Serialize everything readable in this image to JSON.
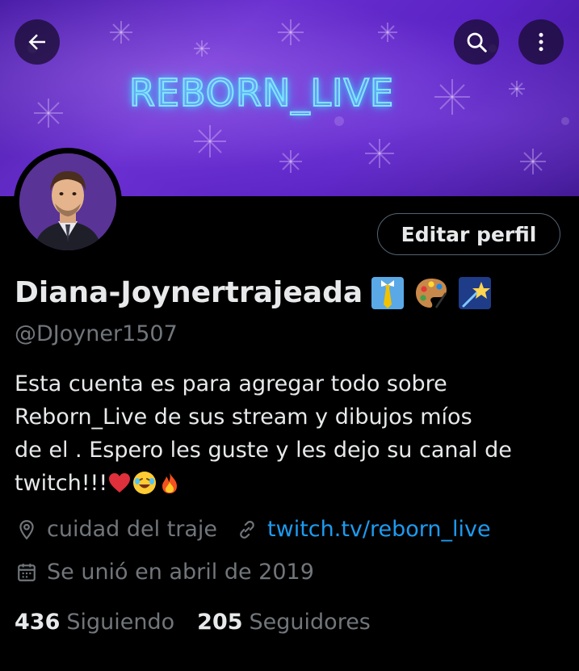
{
  "banner": {
    "title": "REBORN_LIVE",
    "colors": {
      "base": "#5a22c4",
      "neon": "#7fe6ff"
    }
  },
  "header": {
    "back_icon": "arrow-left-icon",
    "search_icon": "search-icon",
    "more_icon": "more-vertical-icon"
  },
  "profile": {
    "avatar_icon": "profile-photo",
    "edit_button_label": "Editar perfil",
    "display_name": "Diana-Joynertrajeada",
    "name_emojis": [
      "necktie-emoji",
      "palette-emoji",
      "shooting-star-emoji"
    ],
    "handle": "@DJoyner1507",
    "bio_lines": [
      "Esta cuenta es para agregar todo sobre",
      "Reborn_Live de sus stream y dibujos míos",
      "de el . Espero les guste y les dejo su canal de",
      "twitch!!!"
    ],
    "bio_emojis": [
      "red-heart-emoji",
      "rolling-laughing-emoji",
      "fire-emoji"
    ],
    "location": "cuidad del traje",
    "website": "twitch.tv/reborn_live",
    "joined": "Se unió en abril de 2019",
    "location_icon": "location-pin-icon",
    "link_icon": "link-icon",
    "calendar_icon": "calendar-icon"
  },
  "stats": {
    "following_count": "436",
    "following_label": "Siguiendo",
    "followers_count": "205",
    "followers_label": "Seguidores"
  },
  "colors": {
    "background": "#000000",
    "text": "#e7e9ea",
    "secondary": "#71767b",
    "link": "#1d9bf0",
    "border": "#536471"
  }
}
